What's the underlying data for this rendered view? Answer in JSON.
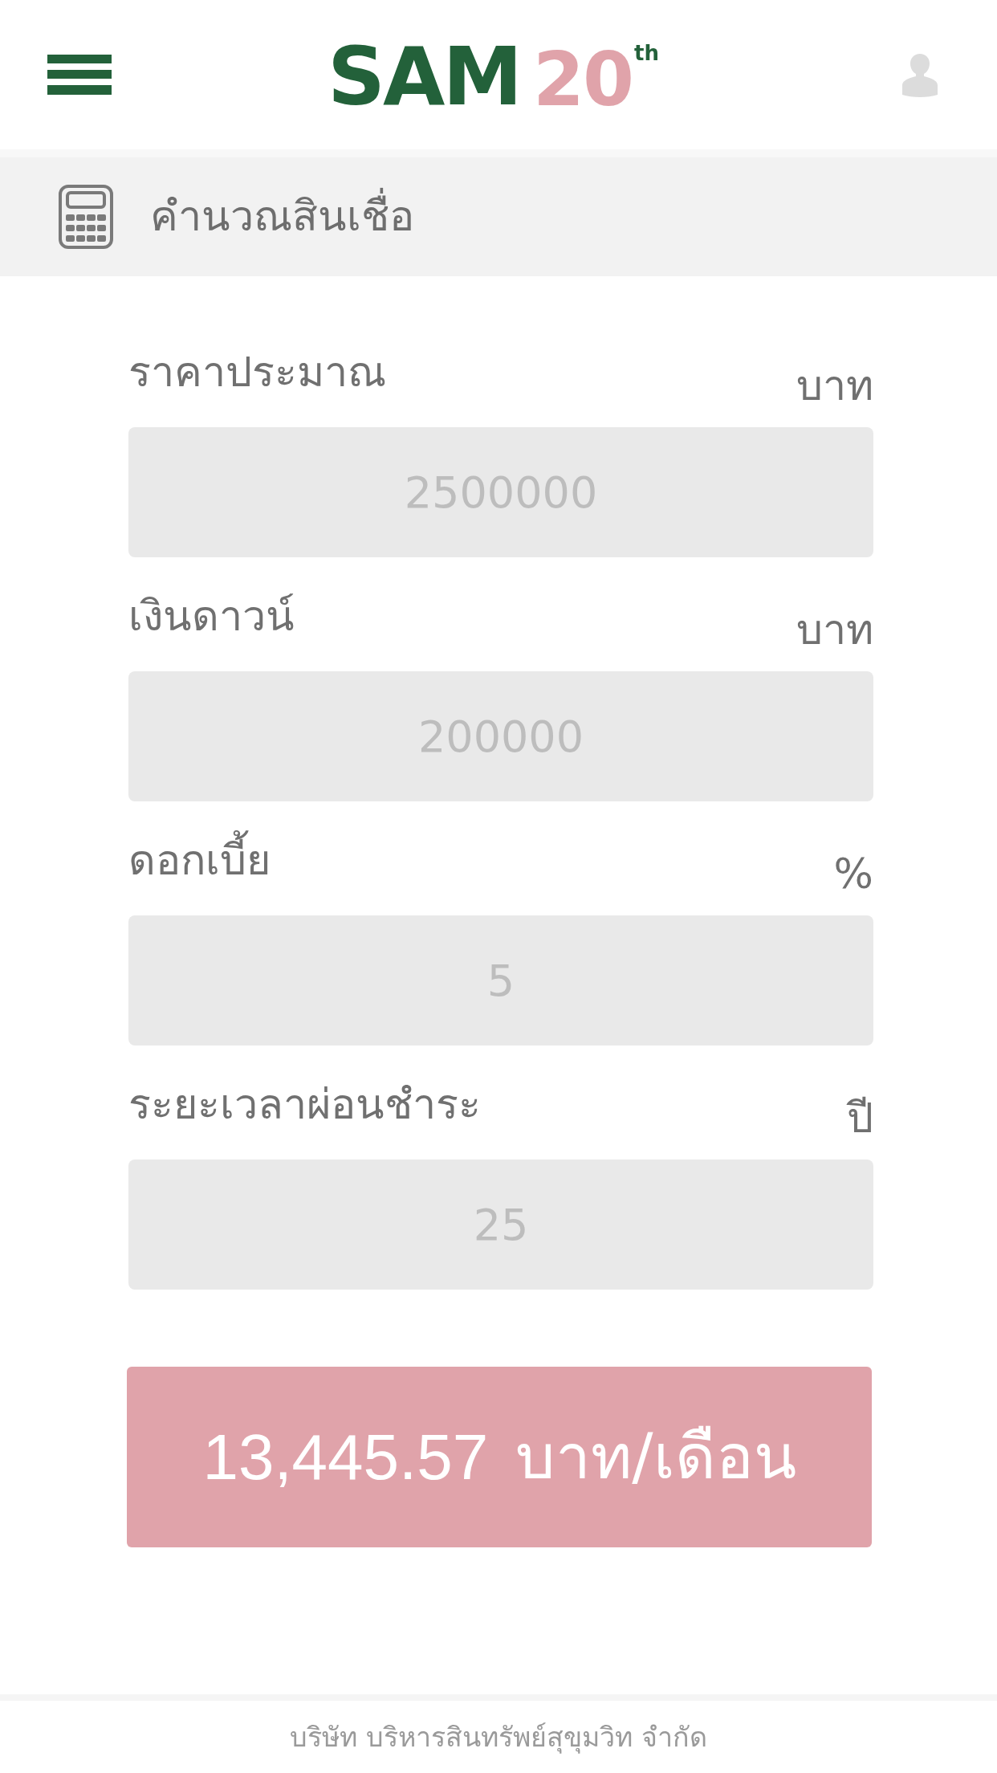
{
  "header": {
    "logo": {
      "name": "SAM",
      "number": "20",
      "ordinal": "th"
    }
  },
  "section": {
    "title": "คำนวณสินเชื่อ"
  },
  "fields": [
    {
      "label": "ราคาประมาณ",
      "unit": "บาท",
      "placeholder": "2500000"
    },
    {
      "label": "เงินดาวน์",
      "unit": "บาท",
      "placeholder": "200000"
    },
    {
      "label": "ดอกเบี้ย",
      "unit": "%",
      "placeholder": "5"
    },
    {
      "label": "ระยะเวลาผ่อนชำระ",
      "unit": "ปี",
      "placeholder": "25"
    }
  ],
  "result": {
    "amount": "13,445.57",
    "unit": "บาท/เดือน"
  },
  "footer": {
    "company": "บริษัท บริหารสินทรัพย์สุขุมวิท จำกัด"
  }
}
